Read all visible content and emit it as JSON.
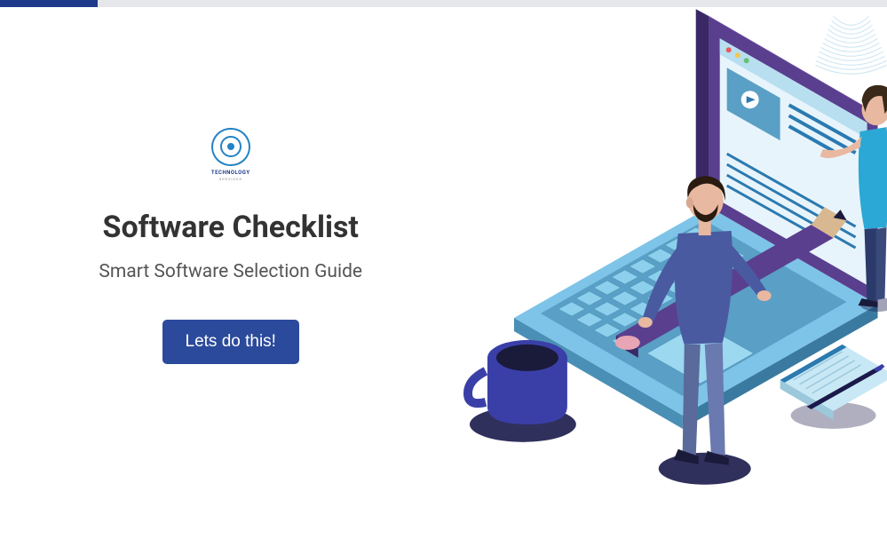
{
  "logo": {
    "name": "TECHNOLOGY",
    "tagline": "SERVICES"
  },
  "hero": {
    "title": "Software Checklist",
    "subtitle": "Smart Software Selection Guide",
    "cta_label": "Lets do this!"
  },
  "progress": {
    "percent": 11
  }
}
